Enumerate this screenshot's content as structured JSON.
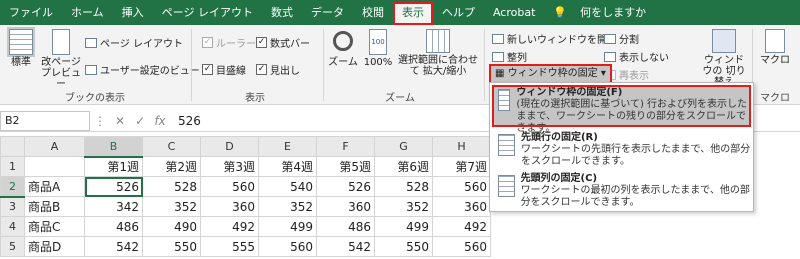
{
  "tabs": [
    "ファイル",
    "ホーム",
    "挿入",
    "ページ レイアウト",
    "数式",
    "データ",
    "校閲",
    "表示",
    "ヘルプ",
    "Acrobat"
  ],
  "tell_me": "何をしますか",
  "ribbon": {
    "book_view": {
      "normal": "標準",
      "page_break": "改ページ プレビュー",
      "page_layout": "ページ レイアウト",
      "custom_view": "ユーザー設定のビュー",
      "label": "ブックの表示"
    },
    "show": {
      "ruler": "ルーラー",
      "formula_bar": "数式バー",
      "gridlines": "目盛線",
      "headings": "見出し",
      "label": "表示"
    },
    "zoom": {
      "zoom": "ズーム",
      "hundred": "100%",
      "selection": "選択範囲に合わせて 拡大/縮小",
      "label": "ズーム"
    },
    "window": {
      "new_window": "新しいウィンドウを開く",
      "arrange": "整列",
      "freeze": "ウィンドウ枠の固定",
      "split": "分割",
      "hide": "表示しない",
      "unhide": "再表示",
      "switch": "ウィンドウの 切り替え",
      "macro": "マクロ",
      "macro_label": "マクロ"
    }
  },
  "formula": {
    "name_box": "B2",
    "value": "526"
  },
  "grid": {
    "columns": [
      "A",
      "B",
      "C",
      "D",
      "E",
      "F",
      "G",
      "H"
    ],
    "rows": [
      {
        "num": "1",
        "a": "",
        "cells": [
          "第1週",
          "第2週",
          "第3週",
          "第4週",
          "第5週",
          "第6週",
          "第7週"
        ]
      },
      {
        "num": "2",
        "a": "商品A",
        "cells": [
          "526",
          "528",
          "560",
          "540",
          "526",
          "528",
          "560"
        ]
      },
      {
        "num": "3",
        "a": "商品B",
        "cells": [
          "342",
          "352",
          "360",
          "352",
          "360",
          "352",
          "360"
        ]
      },
      {
        "num": "4",
        "a": "商品C",
        "cells": [
          "486",
          "490",
          "492",
          "499",
          "486",
          "499",
          "492"
        ]
      },
      {
        "num": "5",
        "a": "商品D",
        "cells": [
          "542",
          "550",
          "555",
          "560",
          "542",
          "550",
          "560"
        ]
      }
    ]
  },
  "menu": [
    {
      "title": "ウィンドウ枠の固定(F)",
      "desc": "(現在の選択範囲に基づいて) 行および列を表示したままで、ワークシートの残りの部分をスクロールできます。"
    },
    {
      "title": "先頭行の固定(R)",
      "desc": "ワークシートの先頭行を表示したままで、他の部分をスクロールできます。"
    },
    {
      "title": "先頭列の固定(C)",
      "desc": "ワークシートの最初の列を表示したままで、他の部分をスクロールできます。"
    }
  ]
}
